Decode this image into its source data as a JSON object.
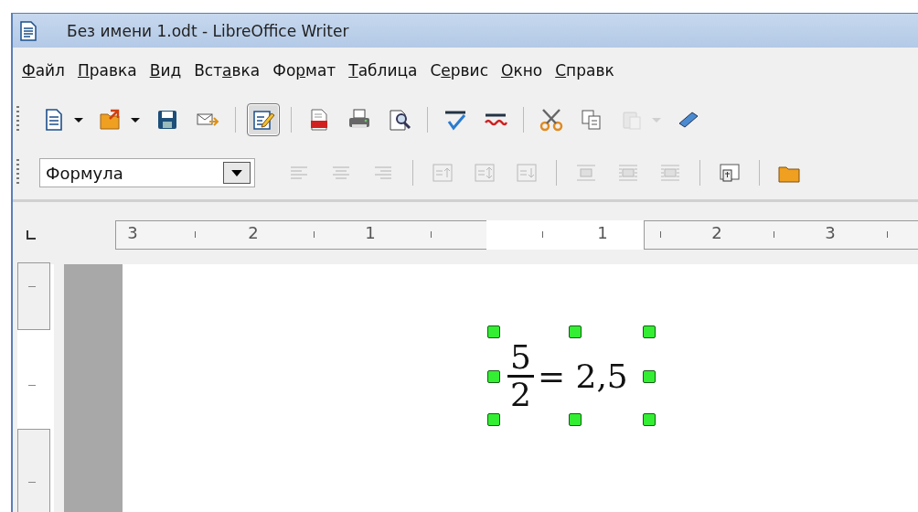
{
  "window": {
    "title": "Без имени 1.odt - LibreOffice Writer"
  },
  "menu": [
    {
      "key": "Ф",
      "post": "айл"
    },
    {
      "key": "П",
      "post": "равка"
    },
    {
      "key": "В",
      "post": "ид"
    },
    {
      "pre": "Вст",
      "key": "а",
      "post": "вка"
    },
    {
      "pre": "Фо",
      "key": "р",
      "post": "мат"
    },
    {
      "key": "Т",
      "post": "аблица"
    },
    {
      "pre": "С",
      "key": "е",
      "post": "рвис"
    },
    {
      "key": "О",
      "post": "кно"
    },
    {
      "key": "С",
      "post": "правк"
    }
  ],
  "toolbar": [
    {
      "kind": "new",
      "dropdown": true,
      "selected": false,
      "disabled": false
    },
    {
      "kind": "open",
      "dropdown": true,
      "selected": false,
      "disabled": false
    },
    {
      "kind": "save",
      "dropdown": false,
      "selected": false,
      "disabled": false
    },
    {
      "kind": "mail",
      "dropdown": false,
      "selected": false,
      "disabled": false
    },
    {
      "kind": "sep"
    },
    {
      "kind": "edit",
      "dropdown": false,
      "selected": true,
      "disabled": false
    },
    {
      "kind": "sep"
    },
    {
      "kind": "pdf",
      "dropdown": false,
      "selected": false,
      "disabled": false
    },
    {
      "kind": "print",
      "dropdown": false,
      "selected": false,
      "disabled": false
    },
    {
      "kind": "preview",
      "dropdown": false,
      "selected": false,
      "disabled": false
    },
    {
      "kind": "sep"
    },
    {
      "kind": "spell",
      "dropdown": false,
      "selected": false,
      "disabled": false
    },
    {
      "kind": "autospell",
      "dropdown": false,
      "selected": false,
      "disabled": false
    },
    {
      "kind": "sep"
    },
    {
      "kind": "cut",
      "dropdown": false,
      "selected": false,
      "disabled": false
    },
    {
      "kind": "copy",
      "dropdown": false,
      "selected": false,
      "disabled": false
    },
    {
      "kind": "paste",
      "dropdown": true,
      "selected": false,
      "disabled": true
    },
    {
      "kind": "brush",
      "dropdown": false,
      "selected": false,
      "disabled": false
    }
  ],
  "format_toolbar": {
    "style": "Формула",
    "buttons": [
      {
        "kind": "align-left",
        "disabled": true
      },
      {
        "kind": "align-center",
        "disabled": true
      },
      {
        "kind": "align-right",
        "disabled": true
      },
      {
        "kind": "sep"
      },
      {
        "kind": "valign-top",
        "disabled": true
      },
      {
        "kind": "valign-middle",
        "disabled": true
      },
      {
        "kind": "valign-bottom",
        "disabled": true
      },
      {
        "kind": "sep"
      },
      {
        "kind": "wrap-none",
        "disabled": true
      },
      {
        "kind": "wrap-through",
        "disabled": true
      },
      {
        "kind": "wrap-full",
        "disabled": true
      },
      {
        "kind": "sep"
      },
      {
        "kind": "frame",
        "disabled": false
      },
      {
        "kind": "sep"
      },
      {
        "kind": "folder",
        "disabled": false
      }
    ]
  },
  "ruler": {
    "labels": [
      "3",
      "2",
      "1",
      "1",
      "2",
      "3"
    ]
  },
  "formula": {
    "numerator": "5",
    "denominator": "2",
    "rest": "= 2,5",
    "selected": true
  }
}
